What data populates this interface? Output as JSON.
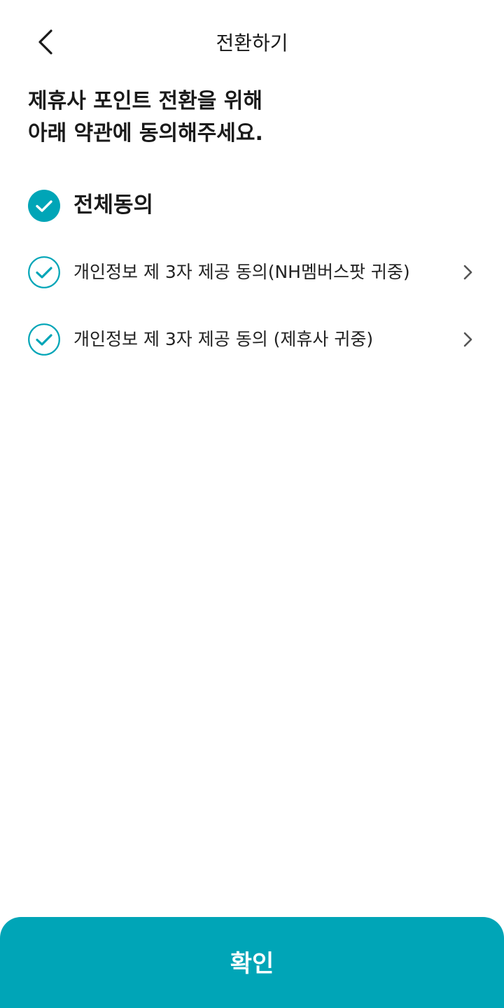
{
  "header": {
    "title": "전환하기",
    "back_icon": "chevron-left-icon"
  },
  "headline": {
    "line1": "제휴사 포인트 전환을 위해",
    "line2": "아래 약관에 동의해주세요."
  },
  "agree_all": {
    "label": "전체동의",
    "checked": true,
    "icon": "check-circle-filled-icon"
  },
  "terms": [
    {
      "label": "개인정보 제 3자 제공 동의(NH멤버스팟 귀중)",
      "checked": true,
      "icon": "check-circle-outline-icon",
      "action_icon": "chevron-right-icon"
    },
    {
      "label": "개인정보 제 3자 제공 동의 (제휴사 귀중)",
      "checked": true,
      "icon": "check-circle-outline-icon",
      "action_icon": "chevron-right-icon"
    }
  ],
  "confirm_button": {
    "label": "확인"
  },
  "colors": {
    "accent": "#00a5b7",
    "text": "#1a1a1a",
    "chevron": "#555555",
    "background": "#ffffff"
  }
}
